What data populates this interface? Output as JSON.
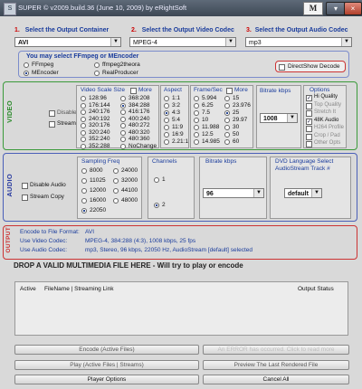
{
  "window": {
    "title": "SUPER © v2009.build.36 (June 10, 2009) by eRightSoft",
    "logo": "M",
    "min": "▾",
    "max": "□",
    "close": "×"
  },
  "headers": {
    "container_num": "1.",
    "container_label": "Select the Output Container",
    "video_num": "2.",
    "video_label": "Select the Output Video Codec",
    "audio_num": "3.",
    "audio_label": "Select the Output Audio Codec"
  },
  "selects": {
    "container": "AVI",
    "video": "MPEG-4",
    "audio": "mp3"
  },
  "encoder": {
    "title": "You may select FFmpeg or MEncoder",
    "options": [
      "FFmpeg",
      "ffmpeg2theora",
      "MEncoder",
      "RealProducer"
    ],
    "directshow": "DirectShow Decode"
  },
  "video": {
    "side": "VIDEO",
    "disable": "Disable Video",
    "stream_copy": "Stream Copy",
    "scale_title": "Video Scale Size",
    "more": "More",
    "sizes": [
      "128:96",
      "176:144",
      "240:176",
      "240:192",
      "320:176",
      "320:240",
      "352:240",
      "352:288",
      "368:208",
      "384:288",
      "416:176",
      "400:240",
      "480:272",
      "480:320",
      "480:360",
      "NoChange"
    ],
    "aspect_title": "Aspect",
    "aspects": [
      "1:1",
      "3:2",
      "4:3",
      "5:4",
      "11:9",
      "16:9",
      "2.21:1"
    ],
    "fps_title": "Frame/Sec",
    "fps": [
      "5.994",
      "6.25",
      "7.5",
      "10",
      "11.988",
      "12.5",
      "14.985",
      "15",
      "23.976",
      "25",
      "29.97",
      "30",
      "50",
      "60"
    ],
    "bitrate_title": "Bitrate  kbps",
    "bitrate": "1008",
    "options_title": "Options",
    "options": [
      "Hi Quality",
      "Top Quality",
      "Stretch It",
      "48K Audio",
      "H264 Profile",
      "Crop / Pad",
      "Other Opts"
    ]
  },
  "audio": {
    "side": "AUDIO",
    "disable": "Disable Audio",
    "stream_copy": "Stream Copy",
    "freq_title": "Sampling Freq",
    "freqs": [
      "8000",
      "11025",
      "12000",
      "16000",
      "22050",
      "24000",
      "32000",
      "44100",
      "48000"
    ],
    "channels_title": "Channels",
    "channels": [
      "1",
      "2"
    ],
    "bitrate_title": "Bitrate  kbps",
    "bitrate": "96",
    "dvd_title": "DVD Language Select",
    "dvd_sub": "AudioStream  Track #",
    "dvd_value": "default"
  },
  "output": {
    "side": "OUTPUT",
    "encode_label": "Encode to File Format:",
    "encode_value": "AVI",
    "video_label": "Use Video Codec:",
    "video_value": "MPEG-4,  384:288 (4:3),  1008 kbps,  25 fps",
    "audio_label": "Use Audio Codec:",
    "audio_value": "mp3,  Stereo,  96 kbps,  22050 Hz,  AudioStream [default] selected"
  },
  "drop_text": "DROP A VALID MULTIMEDIA FILE HERE - Will try to play or encode",
  "table": {
    "col_active": "Active",
    "col_file": "FileName  |  Streaming Link",
    "col_status": "Output Status"
  },
  "buttons": {
    "encode": "Encode (Active Files)",
    "error": "An ERROR has occurred. Click to read more",
    "play": "Play (Active Files | Streams)",
    "preview": "Preview The Last Rendered File",
    "player": "Player Options",
    "cancel": "Cancel All"
  }
}
